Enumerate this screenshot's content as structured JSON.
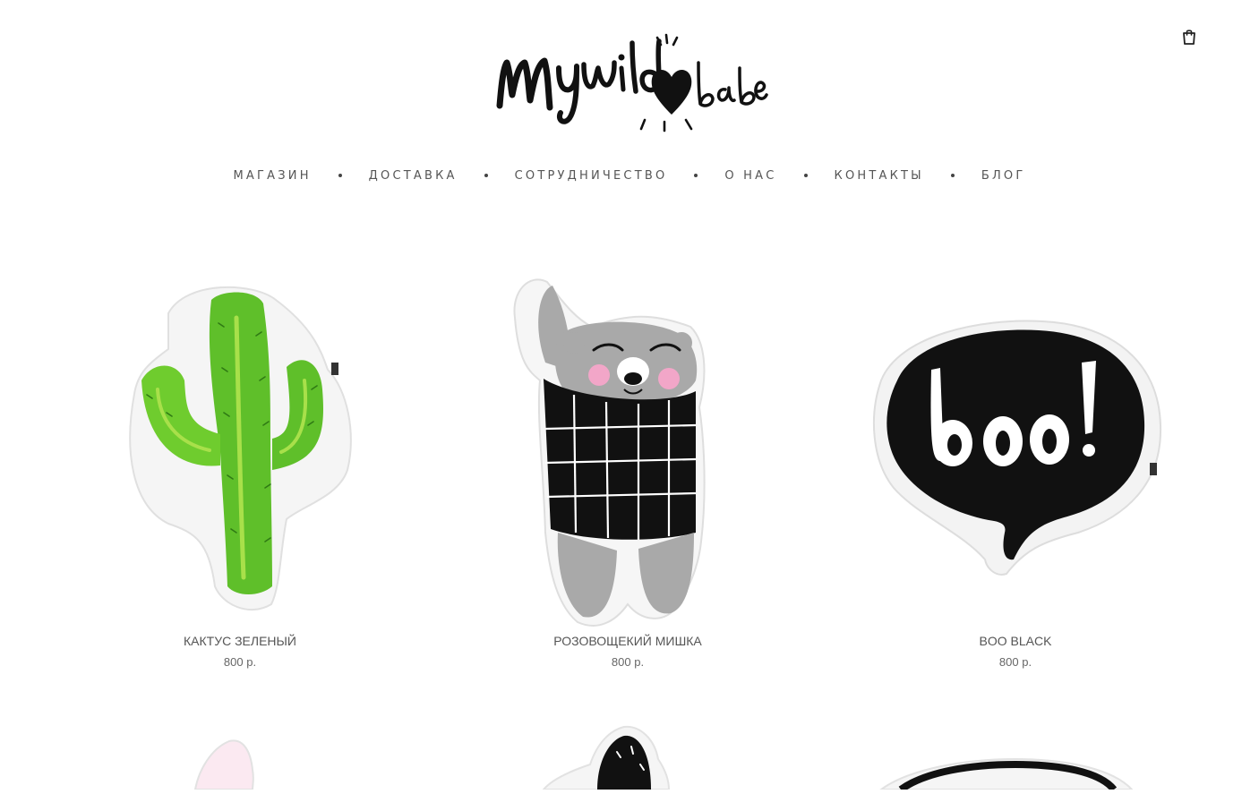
{
  "header": {
    "logo_alt": "mywild babe",
    "cart_icon": "shopping-bag-icon"
  },
  "nav": {
    "items": [
      {
        "label": "МАГАЗИН"
      },
      {
        "label": "ДОСТАВКА"
      },
      {
        "label": "СОТРУДНИЧЕСТВО"
      },
      {
        "label": "О НАС"
      },
      {
        "label": "КОНТАКТЫ"
      },
      {
        "label": "БЛОГ"
      }
    ]
  },
  "products": [
    {
      "title": "КАКТУС ЗЕЛЕНЫЙ",
      "price": "800 р."
    },
    {
      "title": "РОЗОВОЩЕКИЙ МИШКА",
      "price": "800 р."
    },
    {
      "title": "BOO BLACK",
      "price": "800 р."
    }
  ],
  "colors": {
    "cactus_green": "#5fbf2a",
    "cactus_light": "#a8e04a",
    "bear_gray": "#a9a9a9",
    "bear_cheek": "#f2a6c8",
    "black": "#111111"
  }
}
